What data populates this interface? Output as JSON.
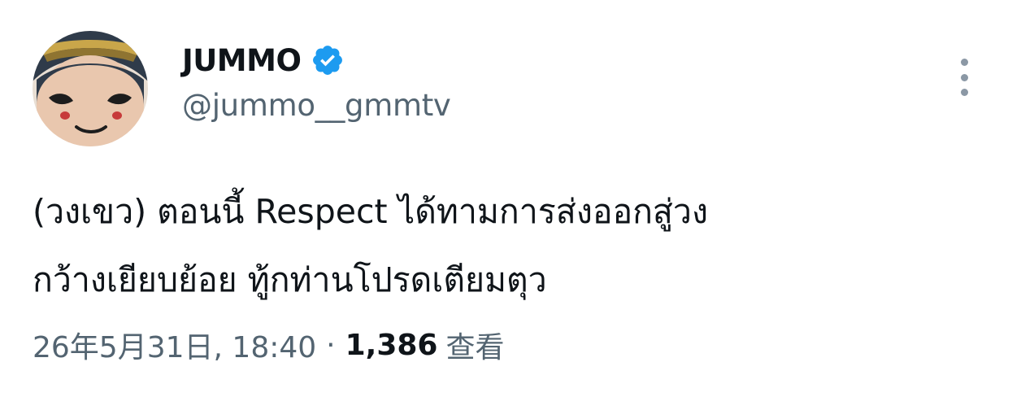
{
  "author": {
    "display_name": "JUMMO",
    "handle": "@jummo__gmmtv",
    "verified": true
  },
  "tweet": {
    "text_lines": [
      "(วงเขว) ตอนนี้ Respect ได้ทามการส่งออกสู่วง",
      "กว้างเยียบย้อย ทู้กท่านโปรดเตียมตุว"
    ],
    "timestamp": "26年5月31日, 18:40",
    "separator": "·",
    "views_count": "1,386",
    "views_label": "查看"
  },
  "colors": {
    "verified_blue": "#1d9bf0",
    "secondary_text": "#536471",
    "primary_text": "#0f1419"
  },
  "icons": {
    "more": "more-vertical-icon",
    "verified": "verified-badge-icon"
  }
}
